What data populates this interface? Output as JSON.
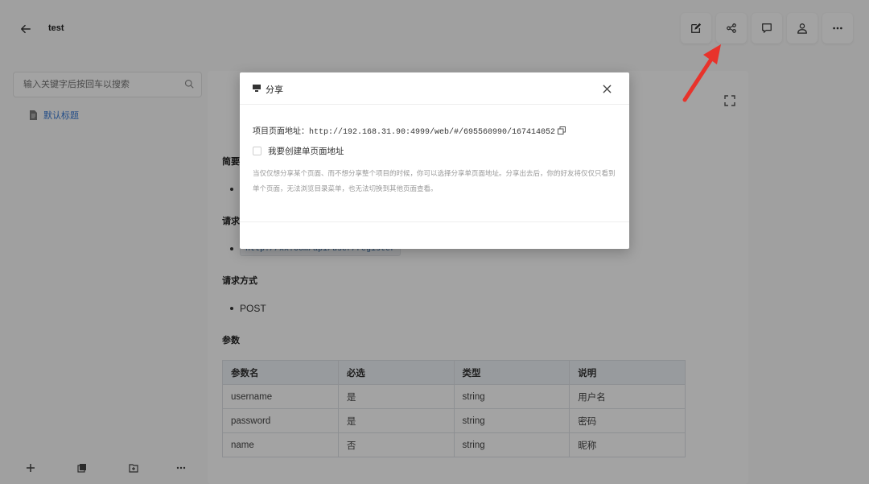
{
  "header": {
    "title": "test"
  },
  "sidebar": {
    "search_placeholder": "输入关键字后按回车以搜索",
    "items": [
      {
        "label": "默认标题"
      }
    ]
  },
  "doc": {
    "sections": {
      "summary": "简要",
      "request_url": "请求",
      "request_method": "请求方式",
      "params": "参数"
    },
    "url_value": "http://xx.com/api/user/register",
    "method_value": "POST",
    "table": {
      "headers": [
        "参数名",
        "必选",
        "类型",
        "说明"
      ],
      "rows": [
        [
          "username",
          "是",
          "string",
          "用户名"
        ],
        [
          "password",
          "是",
          "string",
          "密码"
        ],
        [
          "name",
          "否",
          "string",
          "昵称"
        ]
      ]
    }
  },
  "modal": {
    "title": "分享",
    "address_label": "项目页面地址：",
    "address_url": "http://192.168.31.90:4999/web/#/695560990/167414052",
    "checkbox_label": "我要创建单页面地址",
    "hint": "当仅仅想分享某个页面、而不想分享整个项目的时候，你可以选择分享单页面地址。分享出去后，你的好友将仅仅只看到单个页面，无法浏览目录菜单，也无法切换到其他页面查看。"
  },
  "colors": {
    "link": "#3a7bd5",
    "arrow": "#e8332b",
    "table_header_bg": "#eef2f7"
  }
}
